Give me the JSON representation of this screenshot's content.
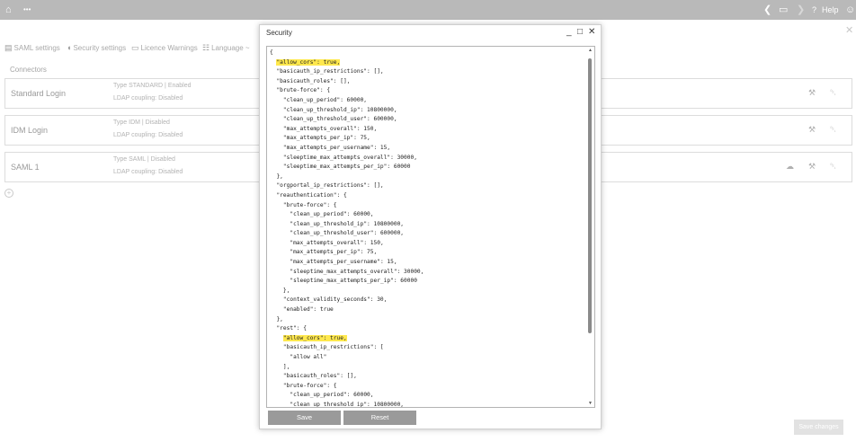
{
  "topbar": {
    "home_icon": "⌂",
    "more_icon": "•••",
    "back_icon": "❮",
    "window_icon": "▭",
    "forward_icon": "❯",
    "help_icon": "?",
    "help_label": "Help",
    "user_icon": "☺"
  },
  "close_icon": "✕",
  "tabs": [
    {
      "icon": "▤",
      "label": "SAML settings"
    },
    {
      "icon": "◖",
      "label": "Security settings"
    },
    {
      "icon": "▭",
      "label": "Licence Warnings"
    },
    {
      "icon": "☷",
      "label": "Language ~"
    }
  ],
  "section_label": "Connectors",
  "connectors": [
    {
      "name": "Standard Login",
      "type": "Type STANDARD  |  Enabled",
      "ldap": "LDAP coupling: Disabled"
    },
    {
      "name": "IDM Login",
      "type": "Type IDM  |  Disabled",
      "ldap": "LDAP coupling: Disabled"
    },
    {
      "name": "SAML 1",
      "type": "Type SAML  |  Disabled",
      "ldap": "LDAP coupling: Disabled"
    }
  ],
  "icons": {
    "cloud": "☁",
    "wrench": "⚒",
    "trash": "␡",
    "add": "+"
  },
  "save_changes_label": "Save changes",
  "dialog": {
    "title": "Security",
    "minimize": "_",
    "maximize": "□",
    "close": "✕",
    "save_label": "Save",
    "reset_label": "Reset",
    "scroll_up": "▲",
    "scroll_down": "▼"
  },
  "code_lines": [
    {
      "pre": "",
      "hl": "",
      "text": "{"
    },
    {
      "pre": "  ",
      "hl": "\"allow_cors\": true,",
      "text": ""
    },
    {
      "pre": "  ",
      "hl": "",
      "text": "\"basicauth_ip_restrictions\": [],"
    },
    {
      "pre": "  ",
      "hl": "",
      "text": "\"basicauth_roles\": [],"
    },
    {
      "pre": "  ",
      "hl": "",
      "text": "\"brute-force\": {"
    },
    {
      "pre": "    ",
      "hl": "",
      "text": "\"clean_up_period\": 60000,"
    },
    {
      "pre": "    ",
      "hl": "",
      "text": "\"clean_up_threshold_ip\": 10800000,"
    },
    {
      "pre": "    ",
      "hl": "",
      "text": "\"clean_up_threshold_user\": 600000,"
    },
    {
      "pre": "    ",
      "hl": "",
      "text": "\"max_attempts_overall\": 150,"
    },
    {
      "pre": "    ",
      "hl": "",
      "text": "\"max_attempts_per_ip\": 75,"
    },
    {
      "pre": "    ",
      "hl": "",
      "text": "\"max_attempts_per_username\": 15,"
    },
    {
      "pre": "    ",
      "hl": "",
      "text": "\"sleeptime_max_attempts_overall\": 30000,"
    },
    {
      "pre": "    ",
      "hl": "",
      "text": "\"sleeptime_max_attempts_per_ip\": 60000"
    },
    {
      "pre": "  ",
      "hl": "",
      "text": "},"
    },
    {
      "pre": "  ",
      "hl": "",
      "text": "\"orgportal_ip_restrictions\": [],"
    },
    {
      "pre": "  ",
      "hl": "",
      "text": "\"reauthentication\": {"
    },
    {
      "pre": "    ",
      "hl": "",
      "text": "\"brute-force\": {"
    },
    {
      "pre": "      ",
      "hl": "",
      "text": "\"clean_up_period\": 60000,"
    },
    {
      "pre": "      ",
      "hl": "",
      "text": "\"clean_up_threshold_ip\": 10800000,"
    },
    {
      "pre": "      ",
      "hl": "",
      "text": "\"clean_up_threshold_user\": 600000,"
    },
    {
      "pre": "      ",
      "hl": "",
      "text": "\"max_attempts_overall\": 150,"
    },
    {
      "pre": "      ",
      "hl": "",
      "text": "\"max_attempts_per_ip\": 75,"
    },
    {
      "pre": "      ",
      "hl": "",
      "text": "\"max_attempts_per_username\": 15,"
    },
    {
      "pre": "      ",
      "hl": "",
      "text": "\"sleeptime_max_attempts_overall\": 30000,"
    },
    {
      "pre": "      ",
      "hl": "",
      "text": "\"sleeptime_max_attempts_per_ip\": 60000"
    },
    {
      "pre": "    ",
      "hl": "",
      "text": "},"
    },
    {
      "pre": "    ",
      "hl": "",
      "text": "\"context_validity_seconds\": 30,"
    },
    {
      "pre": "    ",
      "hl": "",
      "text": "\"enabled\": true"
    },
    {
      "pre": "  ",
      "hl": "",
      "text": "},"
    },
    {
      "pre": "  ",
      "hl": "",
      "text": "\"rest\": {"
    },
    {
      "pre": "    ",
      "hl": "\"allow_cors\": true,",
      "text": ""
    },
    {
      "pre": "    ",
      "hl": "",
      "text": "\"basicauth_ip_restrictions\": ["
    },
    {
      "pre": "      ",
      "hl": "",
      "text": "\"allow all\""
    },
    {
      "pre": "    ",
      "hl": "",
      "text": "],"
    },
    {
      "pre": "    ",
      "hl": "",
      "text": "\"basicauth_roles\": [],"
    },
    {
      "pre": "    ",
      "hl": "",
      "text": "\"brute-force\": {"
    },
    {
      "pre": "      ",
      "hl": "",
      "text": "\"clean_up_period\": 60000,"
    },
    {
      "pre": "      ",
      "hl": "",
      "text": "\"clean_up_threshold_ip\": 10800000,"
    }
  ]
}
